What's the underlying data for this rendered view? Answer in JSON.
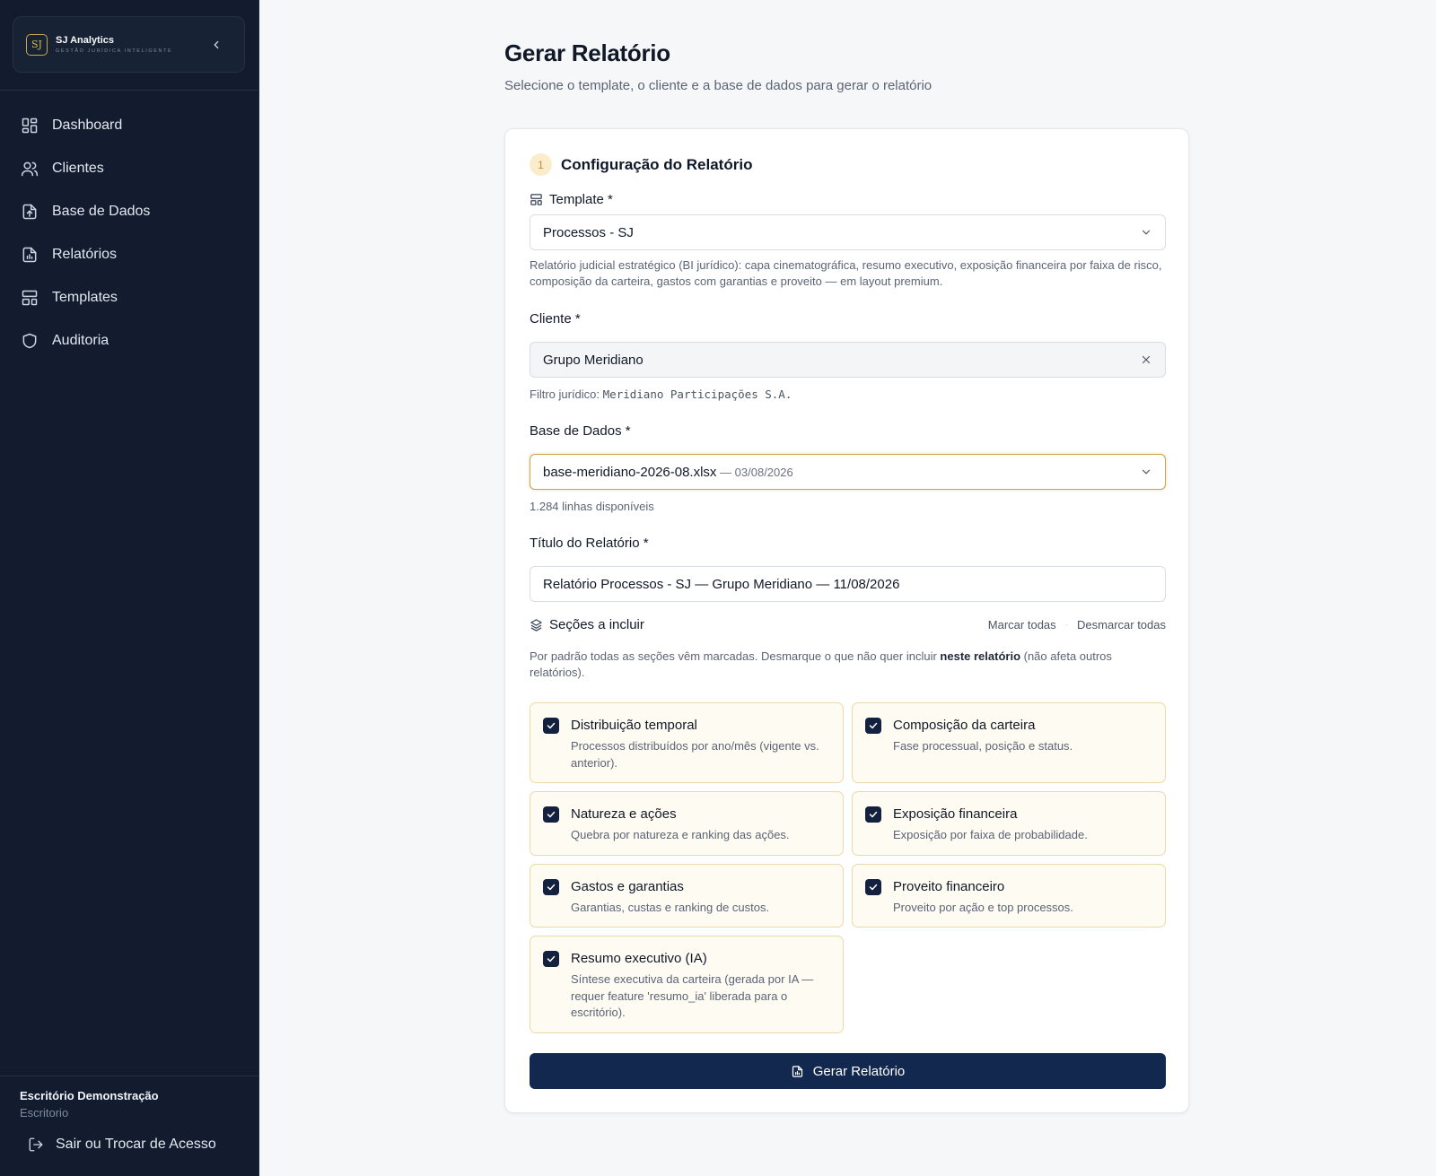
{
  "brand": {
    "logo_text": "SJ",
    "name": "SJ Analytics",
    "tagline": "GESTÃO JURÍDICA INTELIGENTE"
  },
  "sidebar": {
    "items": [
      {
        "label": "Dashboard",
        "icon": "dashboard-icon"
      },
      {
        "label": "Clientes",
        "icon": "users-icon"
      },
      {
        "label": "Base de Dados",
        "icon": "file-upload-icon"
      },
      {
        "label": "Relatórios",
        "icon": "report-icon"
      },
      {
        "label": "Templates",
        "icon": "layout-icon"
      },
      {
        "label": "Auditoria",
        "icon": "shield-icon"
      }
    ],
    "org_name": "Escritório Demonstração",
    "org_role": "Escritorio",
    "logout_label": "Sair ou Trocar de Acesso"
  },
  "page": {
    "title": "Gerar Relatório",
    "subtitle": "Selecione o template, o cliente e a base de dados para gerar o relatório"
  },
  "form": {
    "step_number": "1",
    "step_title": "Configuração do Relatório",
    "template": {
      "label": "Template *",
      "value": "Processos - SJ",
      "help": "Relatório judicial estratégico (BI jurídico): capa cinematográfica, resumo executivo, exposição financeira por faixa de risco, composição da carteira, gastos com garantias e proveito — em layout premium."
    },
    "cliente": {
      "label": "Cliente *",
      "value": "Grupo Meridiano",
      "help_prefix": "Filtro jurídico: ",
      "help_value": "Meridiano Participações S.A."
    },
    "base": {
      "label": "Base de Dados *",
      "value": "base-meridiano-2026-08.xlsx",
      "date": " — 03/08/2026",
      "help": "1.284 linhas disponíveis"
    },
    "titulo": {
      "label": "Título do Relatório *",
      "value": "Relatório Processos - SJ — Grupo Meridiano — 11/08/2026"
    },
    "secoes": {
      "label": "Seções a incluir",
      "select_all": "Marcar todas",
      "separator": "·",
      "deselect_all": "Desmarcar todas",
      "help_before": "Por padrão todas as seções vêm marcadas. Desmarque o que não quer incluir ",
      "help_bold": "neste relatório",
      "help_after": " (não afeta outros relatórios).",
      "items": [
        {
          "title": "Distribuição temporal",
          "desc": "Processos distribuídos por ano/mês (vigente vs. anterior).",
          "checked": true
        },
        {
          "title": "Composição da carteira",
          "desc": "Fase processual, posição e status.",
          "checked": true
        },
        {
          "title": "Natureza e ações",
          "desc": "Quebra por natureza e ranking das ações.",
          "checked": true
        },
        {
          "title": "Exposição financeira",
          "desc": "Exposição por faixa de probabilidade.",
          "checked": true
        },
        {
          "title": "Gastos e garantias",
          "desc": "Garantias, custas e ranking de custos.",
          "checked": true
        },
        {
          "title": "Proveito financeiro",
          "desc": "Proveito por ação e top processos.",
          "checked": true
        },
        {
          "title": "Resumo executivo (IA)",
          "desc": "Síntese executiva da carteira (gerada por IA — requer feature 'resumo_ia' liberada para o escritório).",
          "checked": true
        }
      ]
    },
    "submit_label": "Gerar Relatório"
  },
  "colors": {
    "sidebar_bg": "#131c2e",
    "accent_gold": "#c9a449",
    "primary_navy": "#13284f"
  }
}
